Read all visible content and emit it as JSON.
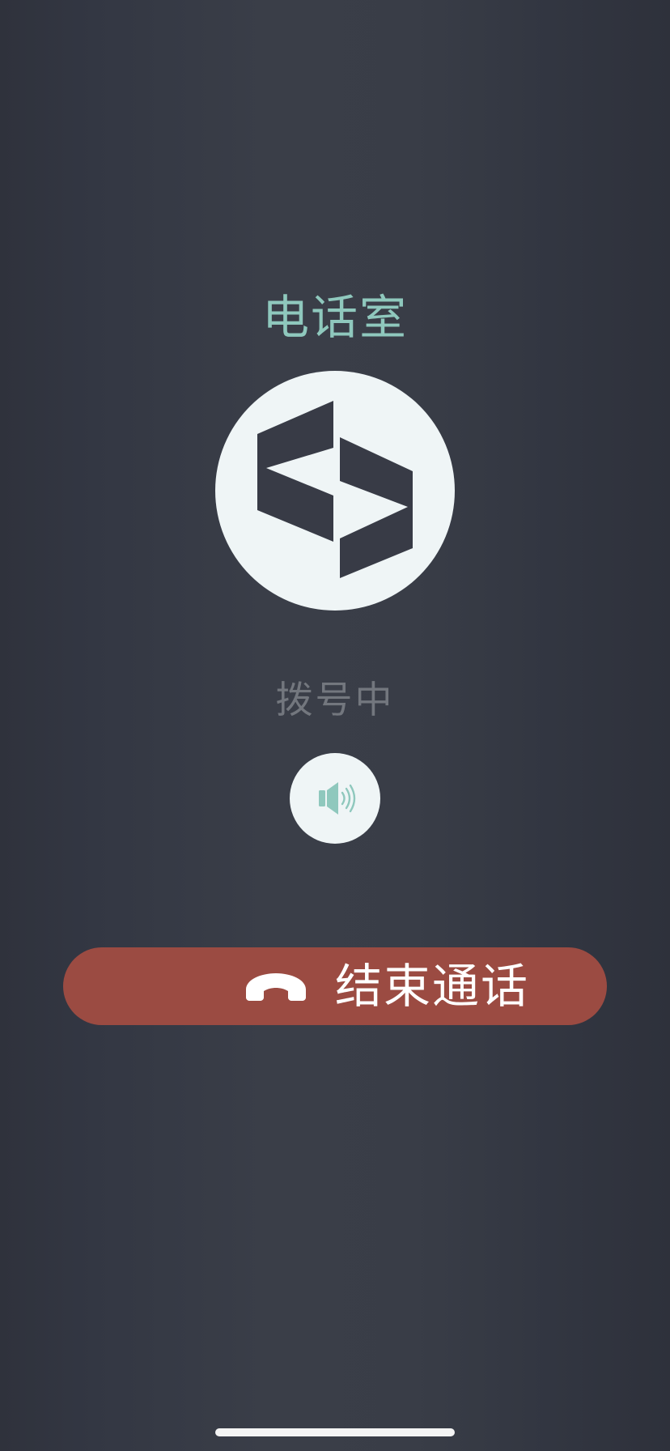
{
  "call": {
    "caller_name": "电话室",
    "status": "拨号中",
    "end_call_label": "结束通话"
  },
  "icons": {
    "avatar": "app-logo",
    "speaker": "speaker-icon",
    "hangup": "phone-hangup-icon"
  },
  "colors": {
    "accent": "#8fc8bd",
    "end_call": "#9b4b42",
    "status_text": "#73777e",
    "background": "#373b45",
    "avatar_bg": "#eff5f6",
    "logo_mark": "#383b46"
  }
}
